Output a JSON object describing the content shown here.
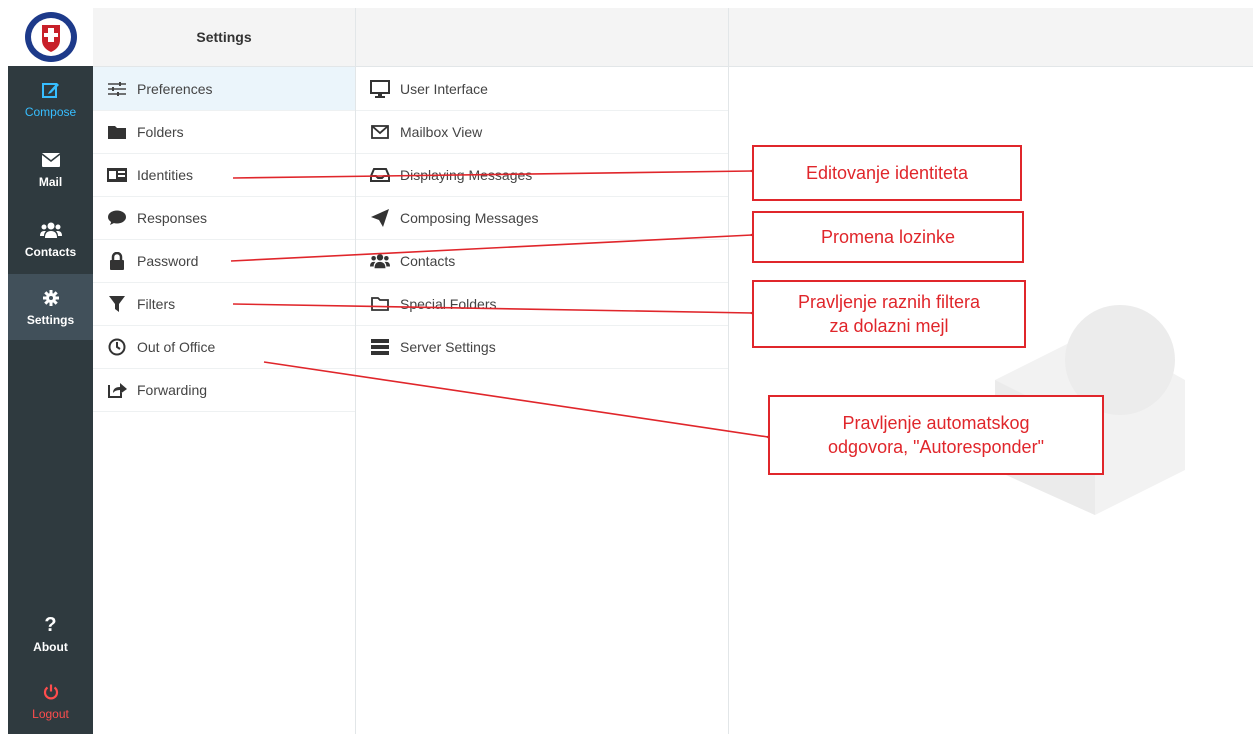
{
  "nav": {
    "compose": "Compose",
    "mail": "Mail",
    "contacts": "Contacts",
    "settings": "Settings",
    "about": "About",
    "logout": "Logout"
  },
  "header": {
    "title": "Settings"
  },
  "settings_list": [
    {
      "label": "Preferences",
      "icon": "sliders-icon"
    },
    {
      "label": "Folders",
      "icon": "folder-icon"
    },
    {
      "label": "Identities",
      "icon": "id-card-icon"
    },
    {
      "label": "Responses",
      "icon": "comment-icon"
    },
    {
      "label": "Password",
      "icon": "lock-icon"
    },
    {
      "label": "Filters",
      "icon": "filter-icon"
    },
    {
      "label": "Out of Office",
      "icon": "clock-icon"
    },
    {
      "label": "Forwarding",
      "icon": "share-icon"
    }
  ],
  "preferences_list": [
    {
      "label": "User Interface",
      "icon": "monitor-icon"
    },
    {
      "label": "Mailbox View",
      "icon": "envelope-icon"
    },
    {
      "label": "Displaying Messages",
      "icon": "inbox-icon"
    },
    {
      "label": "Composing Messages",
      "icon": "paper-plane-icon"
    },
    {
      "label": "Contacts",
      "icon": "users-icon"
    },
    {
      "label": "Special Folders",
      "icon": "folder-open-icon"
    },
    {
      "label": "Server Settings",
      "icon": "server-icon"
    }
  ],
  "annotations": {
    "identities": "Editovanje identiteta",
    "password": "Promena lozinke",
    "filters_line1": "Pravljenje raznih filtera",
    "filters_line2": "za dolazni mejl",
    "office_line1": "Pravljenje automatskog",
    "office_line2": "odgovora, \"Autoresponder\""
  },
  "colors": {
    "nav_bg": "#2f3a3f",
    "accent": "#37beff",
    "annotation": "#e0262b",
    "logout": "#ff4d4d"
  }
}
